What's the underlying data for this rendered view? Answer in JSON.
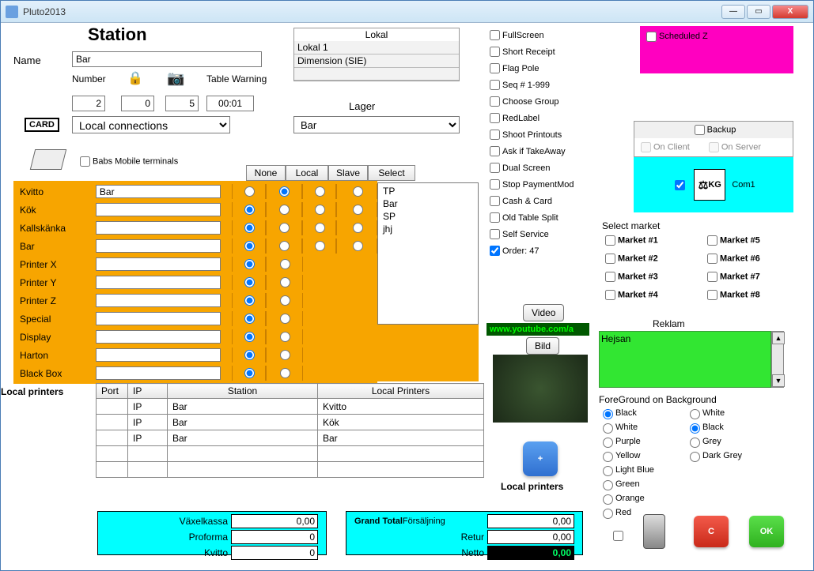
{
  "window": {
    "title": "Pluto2013"
  },
  "station": {
    "heading": "Station",
    "name_label": "Name",
    "name_value": "Bar",
    "number_label": "Number",
    "number_value": "2",
    "lock_value": "0",
    "camera_value": "5",
    "table_warning_label": "Table Warning",
    "table_warning_value": "00:01",
    "card_label": "CARD",
    "connection_select": "Local connections",
    "babs_label": "Babs Mobile terminals"
  },
  "lokal": {
    "title": "Lokal",
    "rows": [
      "Lokal 1",
      "Dimension (SIE)"
    ],
    "lager_label": "Lager",
    "lager_value": "Bar"
  },
  "printers": {
    "headers": [
      "None",
      "Local",
      "Slave",
      "Select"
    ],
    "rows": [
      {
        "label": "Kvitto",
        "value": "Bar",
        "sel": "local"
      },
      {
        "label": "Kök",
        "value": "",
        "sel": "none"
      },
      {
        "label": "Kallskänka",
        "value": "",
        "sel": "none"
      },
      {
        "label": "Bar",
        "value": "",
        "sel": "none"
      },
      {
        "label": "Printer X",
        "value": "",
        "sel": "none"
      },
      {
        "label": "Printer Y",
        "value": "",
        "sel": "none"
      },
      {
        "label": "Printer Z",
        "value": "",
        "sel": "none"
      },
      {
        "label": "Special",
        "value": "",
        "sel": "none"
      },
      {
        "label": "Display",
        "value": "",
        "sel": "none"
      },
      {
        "label": "Harton",
        "value": "",
        "sel": "none"
      },
      {
        "label": "Black Box",
        "value": "",
        "sel": "none"
      }
    ],
    "select_list": [
      "TP",
      "Bar",
      "SP",
      "jhj"
    ]
  },
  "local_printers": {
    "section_label": "Local printers",
    "headers": [
      "Port",
      "IP",
      "Station",
      "Local Printers"
    ],
    "rows": [
      {
        "port": "",
        "ip": "IP",
        "station": "Bar",
        "lp": "Kvitto"
      },
      {
        "port": "",
        "ip": "IP",
        "station": "Bar",
        "lp": "Kök"
      },
      {
        "port": "",
        "ip": "IP",
        "station": "Bar",
        "lp": "Bar"
      },
      {
        "port": "",
        "ip": "",
        "station": "",
        "lp": ""
      },
      {
        "port": "",
        "ip": "",
        "station": "",
        "lp": ""
      }
    ]
  },
  "flags": {
    "items": [
      {
        "label": "FullScreen",
        "checked": false
      },
      {
        "label": "Short Receipt",
        "checked": false
      },
      {
        "label": "Flag Pole",
        "checked": false
      },
      {
        "label": "Seq # 1-999",
        "checked": false
      },
      {
        "label": "Choose Group",
        "checked": false
      },
      {
        "label": "RedLabel",
        "checked": false
      },
      {
        "label": "Shoot Printouts",
        "checked": false
      },
      {
        "label": "Ask if TakeAway",
        "checked": false
      },
      {
        "label": "Dual Screen",
        "checked": false
      },
      {
        "label": "Stop PaymentMod",
        "checked": false
      },
      {
        "label": "Cash & Card",
        "checked": false
      },
      {
        "label": "Old Table Split",
        "checked": false
      },
      {
        "label": "Self Service",
        "checked": false
      },
      {
        "label": "Order: 47",
        "checked": true
      }
    ]
  },
  "scheduled_z": {
    "label": "Scheduled Z"
  },
  "backup": {
    "title": "Backup",
    "on_client": "On Client",
    "on_server": "On Server",
    "com_label": "Com1",
    "weight_label": "KG"
  },
  "markets": {
    "title": "Select market",
    "items": [
      "Market #1",
      "Market #2",
      "Market #3",
      "Market #4",
      "Market #5",
      "Market #6",
      "Market #7",
      "Market #8"
    ]
  },
  "media": {
    "video_btn": "Video",
    "bild_btn": "Bild",
    "url": "www.youtube.com/a",
    "local_printers_btn": "Local printers"
  },
  "reklam": {
    "title": "Reklam",
    "text": "Hejsan"
  },
  "colors": {
    "title": "ForeGround on Background",
    "left": [
      "Black",
      "White",
      "Purple",
      "Yellow",
      "Light Blue",
      "Green",
      "Orange",
      "Red"
    ],
    "right": [
      "White",
      "Black",
      "Grey",
      "Dark Grey"
    ],
    "fg_selected": "Black",
    "bg_selected": "Black"
  },
  "totals_left": {
    "rows": [
      {
        "label": "Växelkassa",
        "value": "0,00"
      },
      {
        "label": "Proforma",
        "value": "0"
      },
      {
        "label": "Kvitto",
        "value": "0"
      }
    ]
  },
  "totals_right": {
    "title_a": "Grand Total",
    "title_b": "Försäljning",
    "rows": [
      {
        "label": "",
        "value": "0,00"
      },
      {
        "label": "Retur",
        "value": "0,00"
      },
      {
        "label": "Netto",
        "value": "0,00"
      }
    ]
  },
  "buttons": {
    "c": "C",
    "ok": "OK",
    "plus": "+"
  }
}
